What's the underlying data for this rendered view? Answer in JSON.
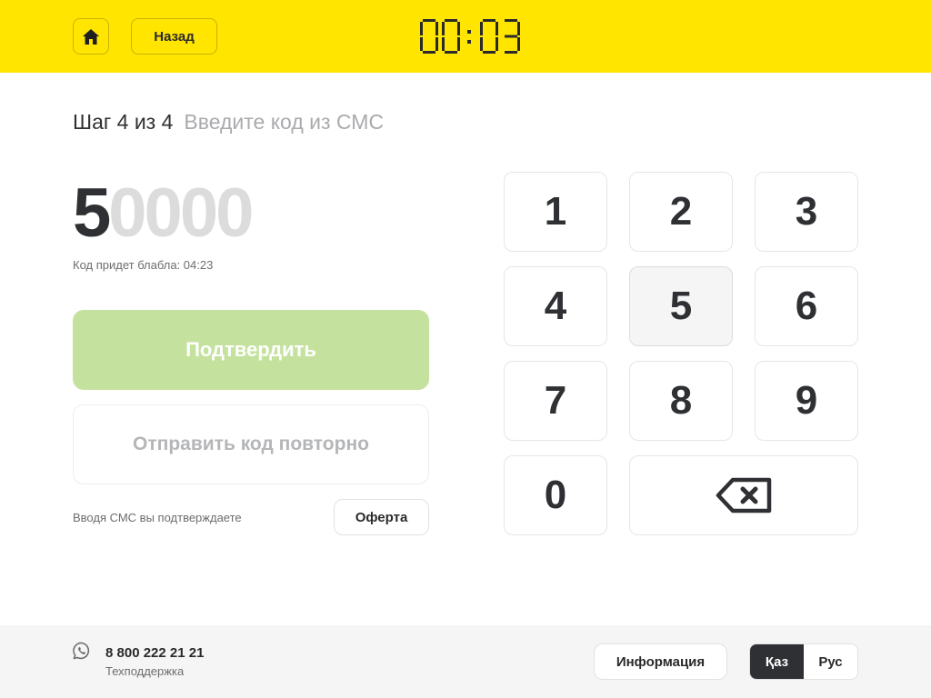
{
  "header": {
    "back_label": "Назад",
    "timer": {
      "minutes": "00",
      "seconds": "03"
    }
  },
  "step": {
    "number": "Шаг 4 из 4",
    "hint": "Введите код из СМС"
  },
  "code": {
    "entered": "5",
    "pending": "0000",
    "hint": "Код придет блабла: 04:23"
  },
  "actions": {
    "confirm_label": "Подтвердить",
    "resend_label": "Отправить код повторно",
    "consent_text": "Вводя СМС вы подтверждаете",
    "offer_label": "Оферта"
  },
  "keypad": {
    "keys": [
      "1",
      "2",
      "3",
      "4",
      "5",
      "6",
      "7",
      "8",
      "9",
      "0"
    ],
    "pressed_key": "5"
  },
  "footer": {
    "phone": "8 800 222 21 21",
    "support_label": "Техподдержка",
    "info_label": "Информация",
    "languages": [
      "Қаз",
      "Рус"
    ],
    "active_language": "Қаз"
  },
  "colors": {
    "header_bg": "#ffe500",
    "confirm_disabled": "#c4e29e",
    "active_lang_bg": "#2f3033"
  },
  "icons": {
    "home": "home-icon",
    "backspace": "backspace-icon",
    "phone": "whatsapp-icon"
  }
}
